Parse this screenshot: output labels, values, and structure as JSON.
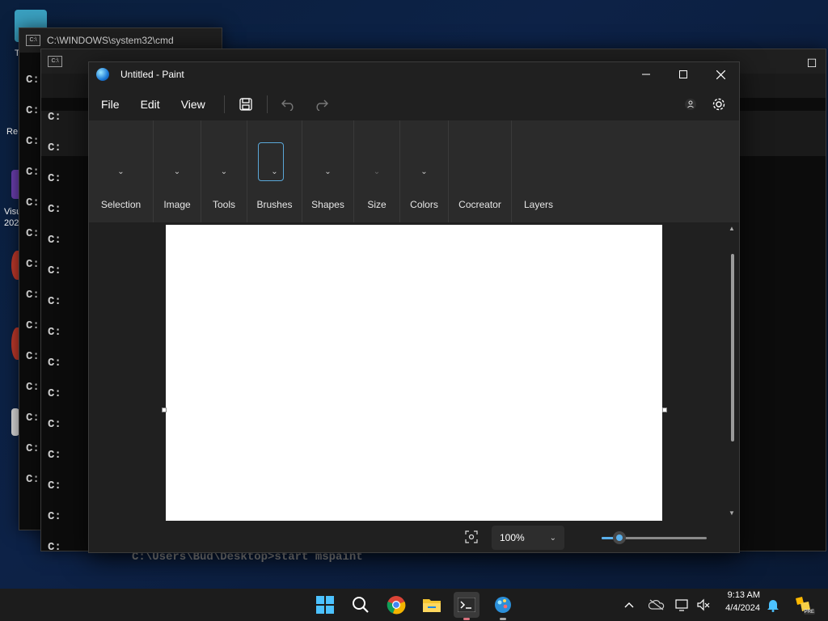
{
  "desktop": {
    "icon_labels": [
      "T",
      "Re",
      "Visu",
      "202"
    ]
  },
  "background_windows": {
    "cmd_title": "C:\\WINDOWS\\system32\\cmd",
    "prompt_fragment": "C:",
    "behind_text": "C:\\Users\\Bud\\Desktop>start mspaint"
  },
  "paint": {
    "title": "Untitled - Paint",
    "menu": {
      "file": "File",
      "edit": "Edit",
      "view": "View"
    },
    "toolbar_icons": [
      "save-icon",
      "undo-icon",
      "redo-icon"
    ],
    "ribbon": {
      "groups": [
        {
          "key": "selection",
          "label": "Selection"
        },
        {
          "key": "image",
          "label": "Image"
        },
        {
          "key": "tools",
          "label": "Tools"
        },
        {
          "key": "brushes",
          "label": "Brushes"
        },
        {
          "key": "shapes",
          "label": "Shapes"
        },
        {
          "key": "size",
          "label": "Size"
        },
        {
          "key": "colors",
          "label": "Colors"
        },
        {
          "key": "cocreator",
          "label": "Cocreator"
        },
        {
          "key": "layers",
          "label": "Layers"
        }
      ]
    },
    "status": {
      "zoom_value": "100%",
      "zoom_slider_level": 0.17
    },
    "colors": {
      "accent": "#5ab0ec",
      "window_bg": "#202020",
      "ribbon_bg": "#2b2b2b",
      "canvas": "#ffffff"
    }
  },
  "taskbar": {
    "apps": [
      "windows-start-icon",
      "search-icon",
      "chrome-icon",
      "file-explorer-icon",
      "terminal-icon",
      "paint-icon"
    ],
    "time": "9:13 AM",
    "date": "4/4/2024",
    "badge": "PRE"
  }
}
